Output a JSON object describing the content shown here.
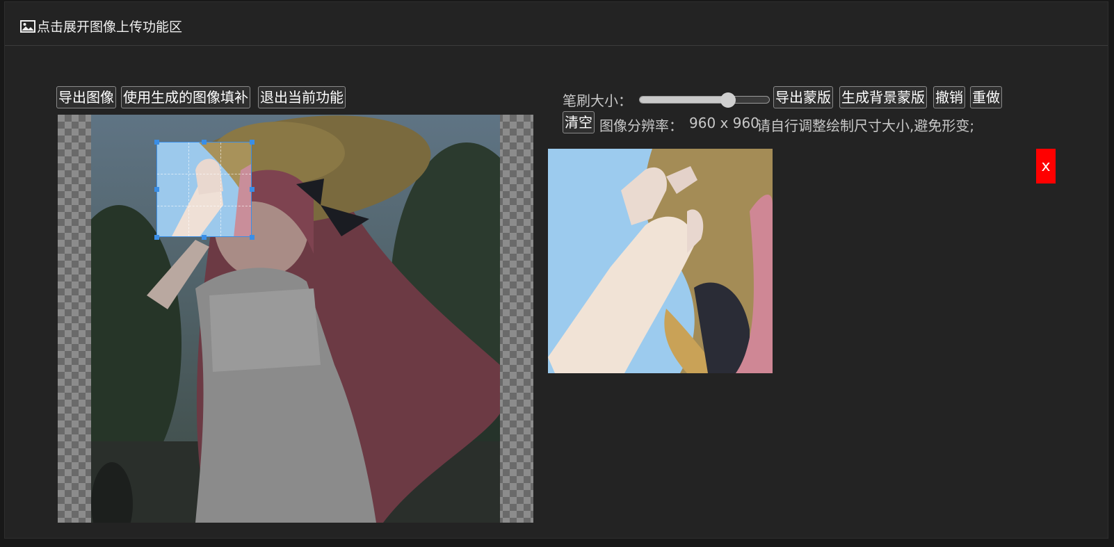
{
  "header": {
    "icon": "image-icon",
    "title": "点击展开图像上传功能区"
  },
  "left_toolbar": {
    "export_image": "导出图像",
    "fill_with_generated": "使用生成的图像填补",
    "exit_function": "退出当前功能"
  },
  "right_toolbar": {
    "brush_size_label": "笔刷大小：",
    "brush_size_value": 0.68,
    "export_mask": "导出蒙版",
    "generate_bg_mask": "生成背景蒙版",
    "undo": "撤销",
    "redo": "重做",
    "clear": "清空",
    "resolution_label": "图像分辨率：",
    "resolution_value": "960 x 960",
    "resolution_hint": "请自行调整绘制尺寸大小,避免形变;"
  },
  "close_button": "x",
  "colors": {
    "background": "#232323",
    "close_red": "#ff0000",
    "selection_blue": "#3a8ee6"
  }
}
